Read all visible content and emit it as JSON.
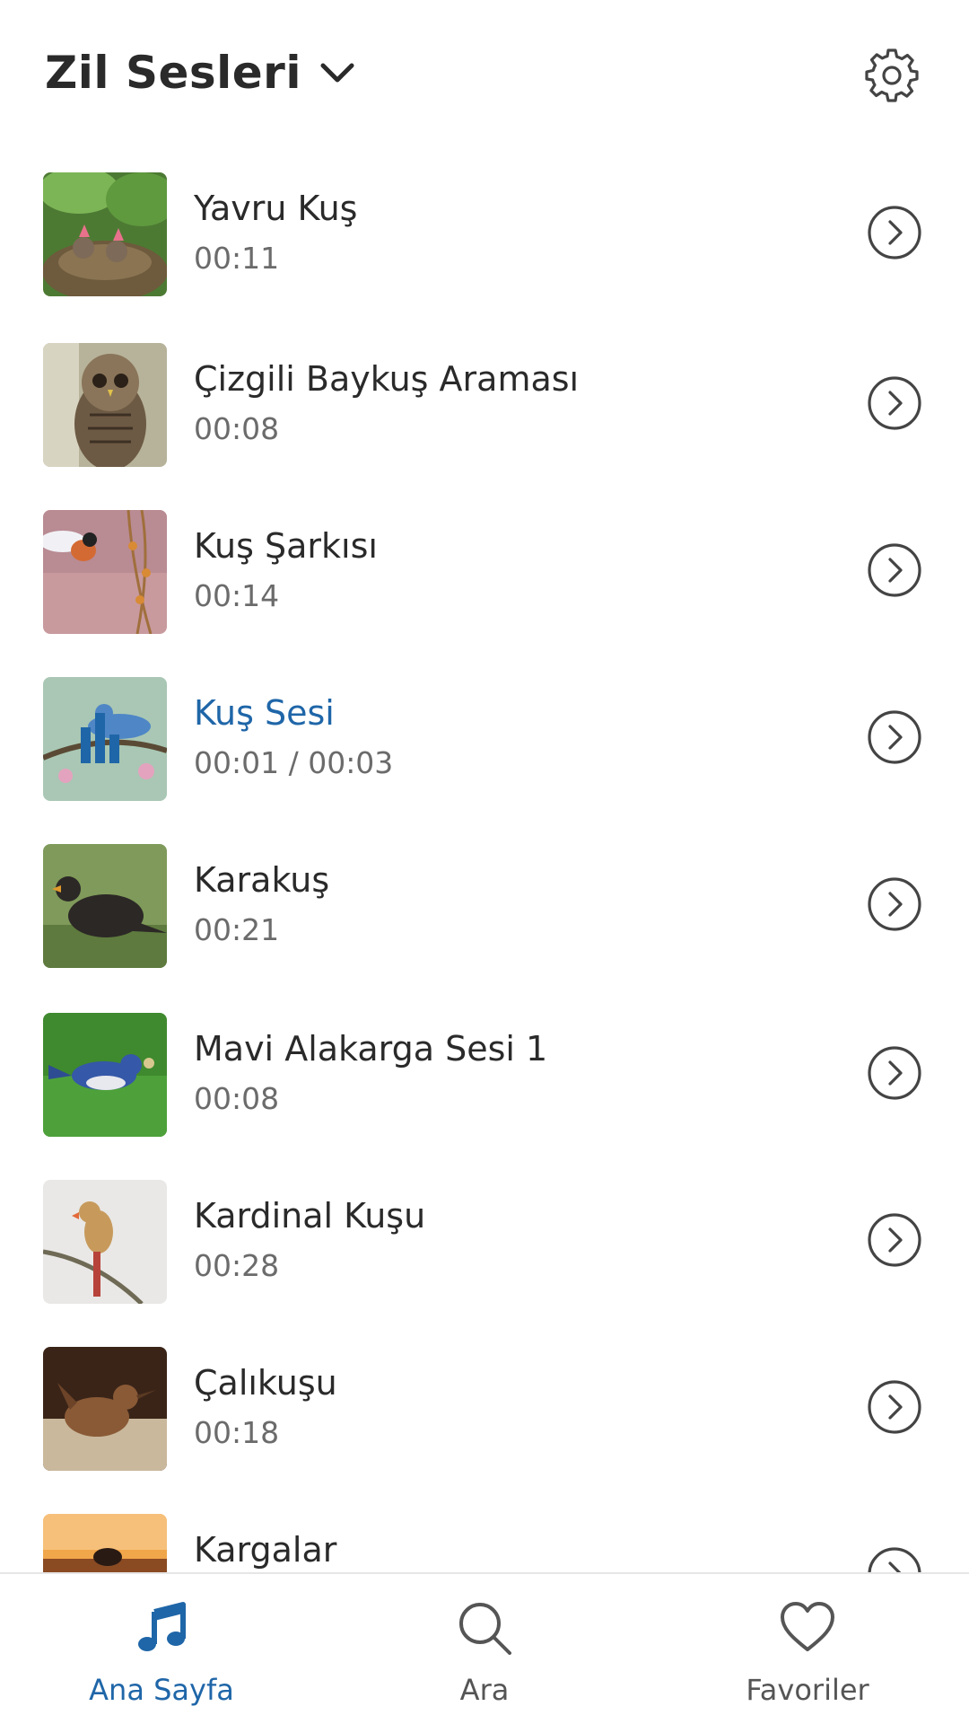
{
  "header": {
    "title": "Zil Sesleri",
    "dropdown_icon": "chevron-down-icon",
    "settings_icon": "gear-icon"
  },
  "list": {
    "items": [
      {
        "name": "Yavru Kuş",
        "duration": "00:11",
        "thumb": "baby-birds-in-nest",
        "playing": false
      },
      {
        "name": "Çizgili Baykuş Araması",
        "duration": "00:08",
        "thumb": "barred-owl",
        "playing": false
      },
      {
        "name": "Kuş Şarkısı",
        "duration": "00:14",
        "thumb": "bird-in-flight-flowers",
        "playing": false
      },
      {
        "name": "Kuş Sesi",
        "duration": "00:01 / 00:03",
        "thumb": "bluebird-on-branch",
        "playing": true
      },
      {
        "name": "Karakuş",
        "duration": "00:21",
        "thumb": "blackbird-on-grass",
        "playing": false
      },
      {
        "name": "Mavi Alakarga Sesi 1",
        "duration": "00:08",
        "thumb": "blue-jay-on-grass",
        "playing": false
      },
      {
        "name": "Kardinal Kuşu",
        "duration": "00:28",
        "thumb": "female-cardinal",
        "playing": false
      },
      {
        "name": "Çalıkuşu",
        "duration": "00:18",
        "thumb": "wren",
        "playing": false
      },
      {
        "name": "Kargalar",
        "duration": "",
        "thumb": "crow-sunset",
        "playing": false
      }
    ],
    "row_action_icon": "chevron-right-circle-icon"
  },
  "tabs": [
    {
      "label": "Ana Sayfa",
      "icon": "music-note-icon",
      "active": true
    },
    {
      "label": "Ara",
      "icon": "search-icon",
      "active": false
    },
    {
      "label": "Favoriler",
      "icon": "heart-icon",
      "active": false
    }
  ],
  "colors": {
    "accent": "#1f66a8",
    "text": "#2a2a2a",
    "muted": "#6b6b6b",
    "icon": "#444444"
  }
}
